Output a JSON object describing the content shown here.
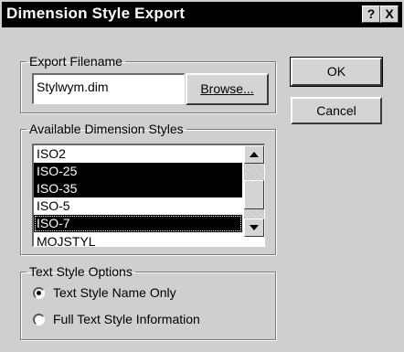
{
  "window": {
    "title": "Dimension Style Export",
    "help_label": "?",
    "close_label": "X"
  },
  "export_filename": {
    "legend": "Export Filename",
    "value": "Stylwym.dim",
    "browse_label": "Browse..."
  },
  "buttons": {
    "ok_label": "OK",
    "cancel_label": "Cancel"
  },
  "styles": {
    "legend": "Available Dimension Styles",
    "items": [
      {
        "label": "ISO2",
        "selected": false
      },
      {
        "label": "ISO-25",
        "selected": true
      },
      {
        "label": "ISO-35",
        "selected": true
      },
      {
        "label": "ISO-5",
        "selected": false
      },
      {
        "label": "ISO-7",
        "selected": true
      },
      {
        "label": "MOJSTYL",
        "selected": false
      }
    ]
  },
  "text_style": {
    "legend": "Text Style Options",
    "options": [
      {
        "label": "Text Style Name Only",
        "checked": true
      },
      {
        "label": "Full Text Style Information",
        "checked": false
      }
    ]
  }
}
